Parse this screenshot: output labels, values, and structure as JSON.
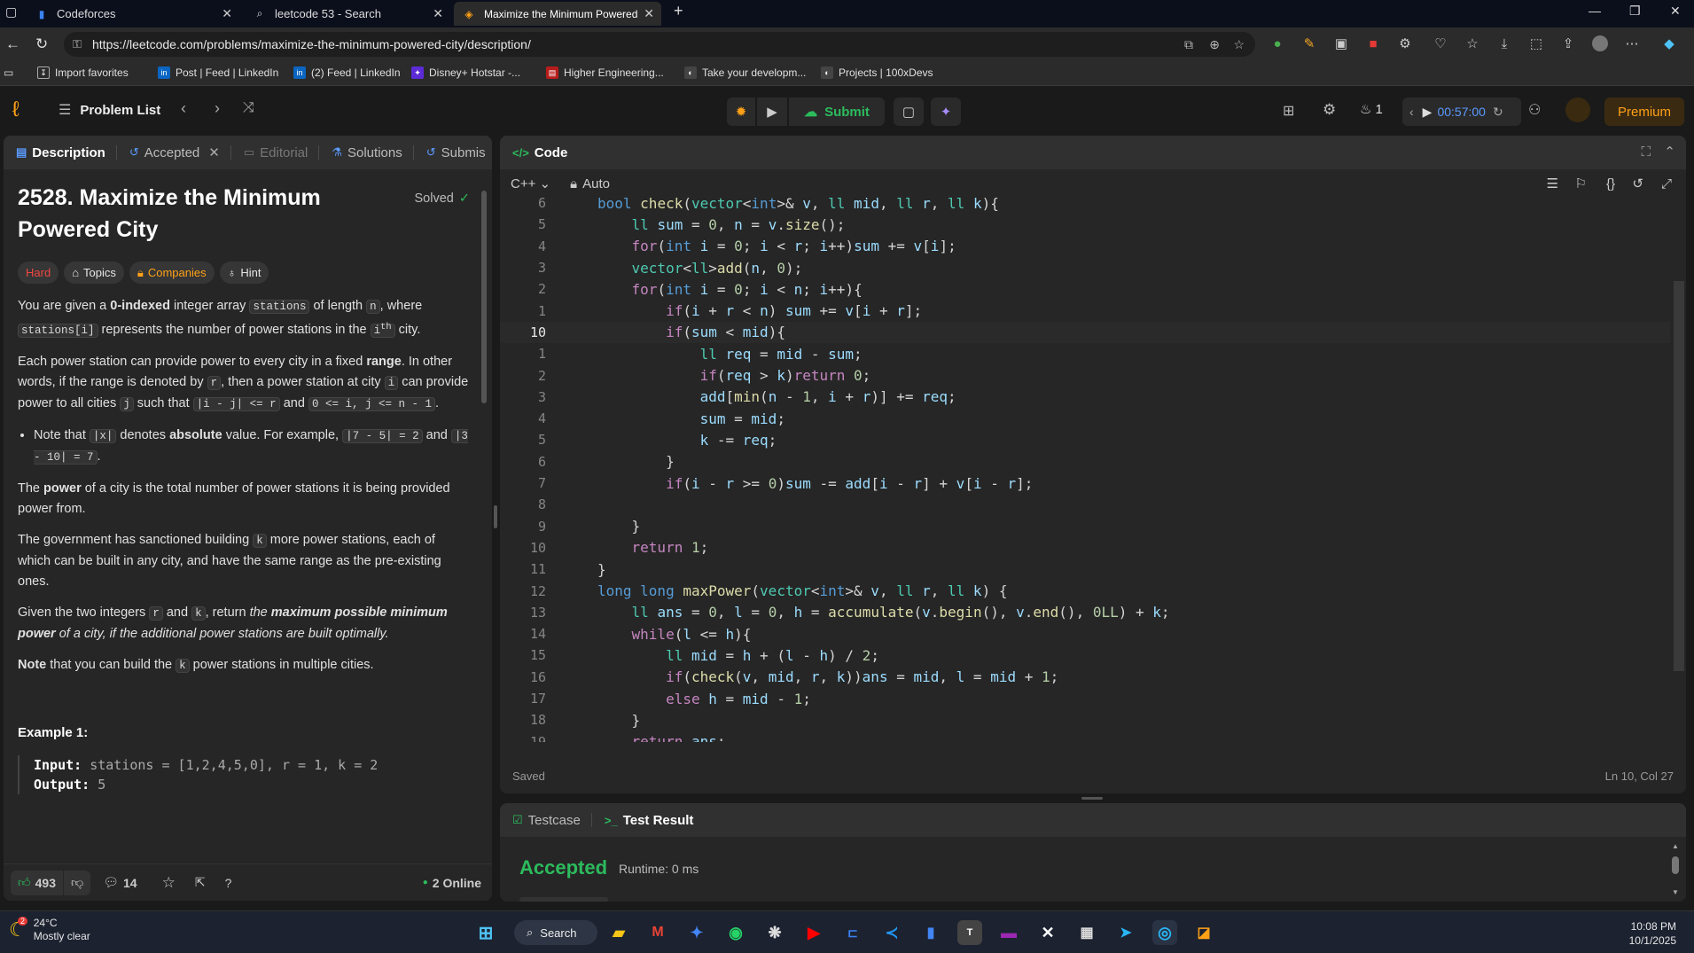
{
  "browser": {
    "tabs": [
      {
        "title": "Codeforces",
        "active": false
      },
      {
        "title": "leetcode 53 - Search",
        "active": false
      },
      {
        "title": "Maximize the Minimum Powered",
        "active": true
      }
    ],
    "url": "https://leetcode.com/problems/maximize-the-minimum-powered-city/description/",
    "bookmarks": [
      "Import favorites",
      "Post | Feed | LinkedIn",
      "(2) Feed | LinkedIn",
      "Disney+ Hotstar -...",
      "Higher Engineering...",
      "Take your developm...",
      "Projects | 100xDevs"
    ]
  },
  "header": {
    "problem_list": "Problem List",
    "submit": "Submit",
    "streak": "1",
    "timer": "00:57:00",
    "premium": "Premium"
  },
  "left_tabs": [
    "Description",
    "Accepted",
    "Editorial",
    "Solutions",
    "Submis"
  ],
  "problem": {
    "title": "2528. Maximize the Minimum Powered City",
    "status": "Solved",
    "difficulty": "Hard",
    "tags": [
      "Topics",
      "Companies",
      "Hint"
    ],
    "example_heading": "Example 1:",
    "example_input_label": "Input:",
    "example_input": "stations = [1,2,4,5,0], r = 1, k = 2",
    "example_output_label": "Output:",
    "example_output": "5"
  },
  "left_footer": {
    "likes": "493",
    "comments": "14",
    "online": "2 Online"
  },
  "code": {
    "title": "Code",
    "language": "C++",
    "mode": "Auto",
    "status": "Saved",
    "cursor": "Ln 10, Col 27"
  },
  "test": {
    "tabs": [
      "Testcase",
      "Test Result"
    ],
    "result": "Accepted",
    "runtime": "Runtime: 0 ms"
  },
  "taskbar": {
    "weather_temp": "24°C",
    "weather_desc": "Mostly clear",
    "weather_badge": "2",
    "search": "Search",
    "time": "10:08 PM",
    "date": "10/1/2025"
  },
  "colors": {
    "accent_green": "#2cbb5d",
    "hard": "#ef4743",
    "companies": "#ffa116",
    "bg": "#1a1a1a",
    "panel": "#262626"
  }
}
